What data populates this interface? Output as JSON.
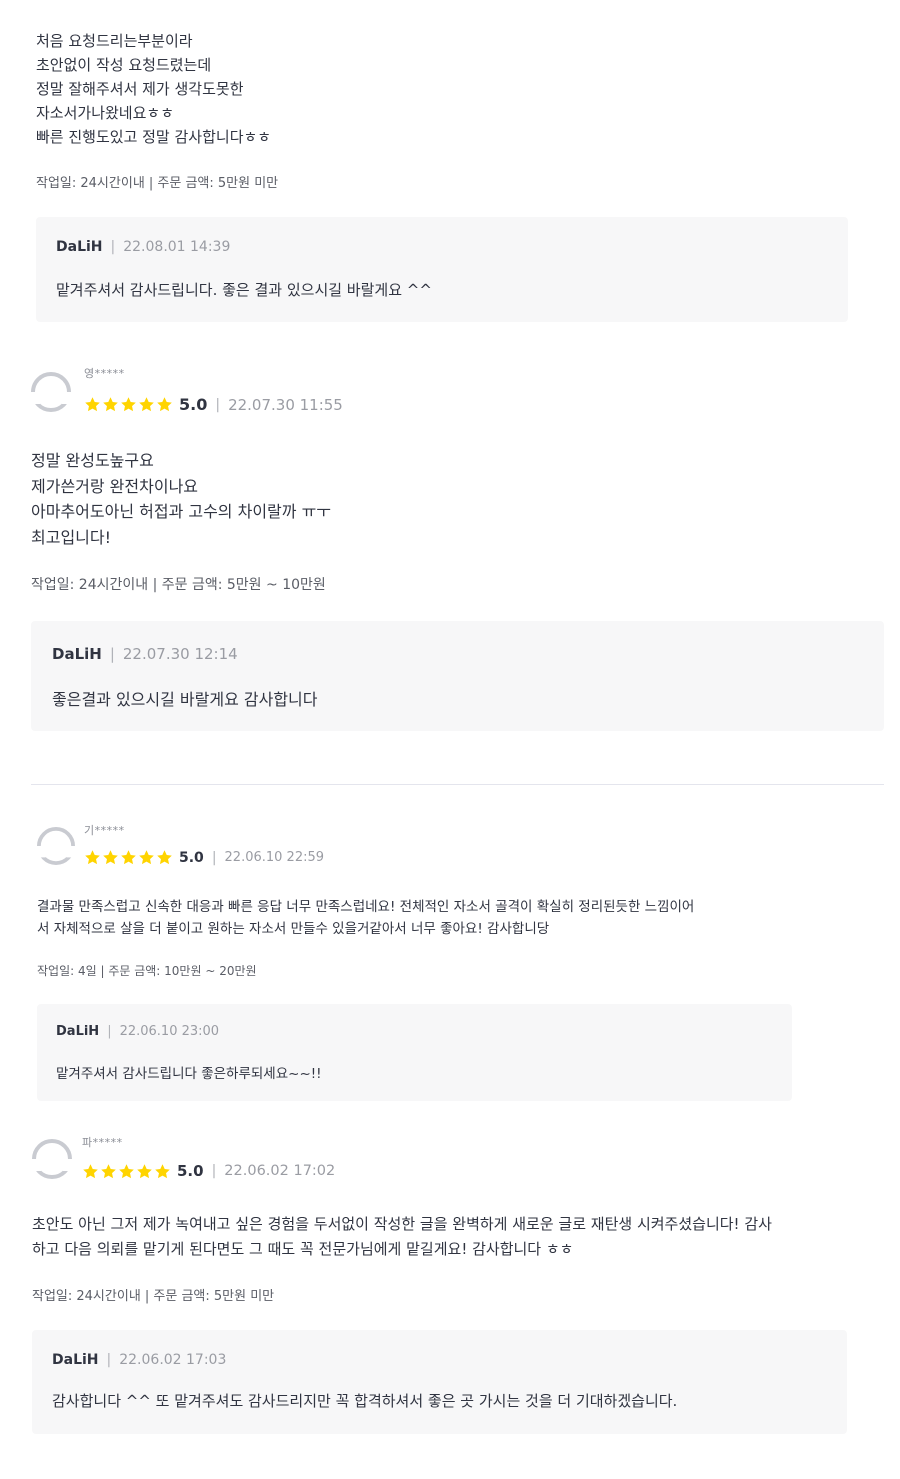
{
  "reviews": [
    {
      "body": "처음 요청드리는부분이라\n초안없이 작성 요청드렸는데\n정말 잘해주셔서 제가 생각도못한\n자소서가나왔네요ㅎㅎ\n빠른 진행도있고 정말 감사합니다ㅎㅎ",
      "meta": "작업일: 24시간이내 | 주문 금액: 5만원 미만",
      "reply": {
        "seller": "DaLiH",
        "date": "22.08.01 14:39",
        "text": "맡겨주셔서 감사드립니다. 좋은 결과 있으시길 바랄게요 ^^"
      }
    },
    {
      "nickname": "영*****",
      "score": "5.0",
      "date": "22.07.30 11:55",
      "rating": 5,
      "body": "정말 완성도높구요\n제가쓴거랑 완전차이나요\n아마추어도아닌 허접과 고수의 차이랄까 ㅠㅜ\n최고입니다!",
      "meta": "작업일: 24시간이내 | 주문 금액: 5만원 ~ 10만원",
      "reply": {
        "seller": "DaLiH",
        "date": "22.07.30 12:14",
        "text": "좋은결과 있으시길 바랄게요 감사합니다"
      }
    },
    {
      "nickname": "기*****",
      "score": "5.0",
      "date": "22.06.10 22:59",
      "rating": 5,
      "body": "결과물 만족스럽고 신속한 대응과 빠른 응답 너무 만족스럽네요! 전체적인 자소서 골격이 확실히 정리된듯한 느낌이어\n서 자체적으로 살을 더 붙이고 원하는 자소서 만들수 있을거같아서 너무 좋아요! 감사합니당",
      "meta": "작업일: 4일 | 주문 금액: 10만원 ~ 20만원",
      "reply": {
        "seller": "DaLiH",
        "date": "22.06.10 23:00",
        "text": "맡겨주셔서 감사드립니다 좋은하루되세요~~!!"
      }
    },
    {
      "nickname": "파*****",
      "score": "5.0",
      "date": "22.06.02 17:02",
      "rating": 5,
      "body": "초안도 아닌 그저 제가 녹여내고 싶은 경험을 두서없이 작성한 글을 완벽하게 새로운 글로 재탄생 시켜주셨습니다! 감사\n하고 다음 의뢰를 맡기게 된다면도 그  때도 꼭 전문가님에게 맡길게요! 감사합니다 ㅎㅎ",
      "meta": "작업일: 24시간이내 | 주문 금액: 5만원 미만",
      "reply": {
        "seller": "DaLiH",
        "date": "22.06.02 17:03",
        "text": "감사합니다 ^^ 또 맡겨주셔도 감사드리지만 꼭 합격하셔서 좋은 곳 가시는 것을 더 기대하겠습니다."
      }
    }
  ],
  "colors": {
    "star": "#FFD400",
    "text": "#303441",
    "reply_bg": "#F7F7F8"
  },
  "icons": {
    "avatar": "default-profile-icon",
    "star": "star-icon"
  }
}
